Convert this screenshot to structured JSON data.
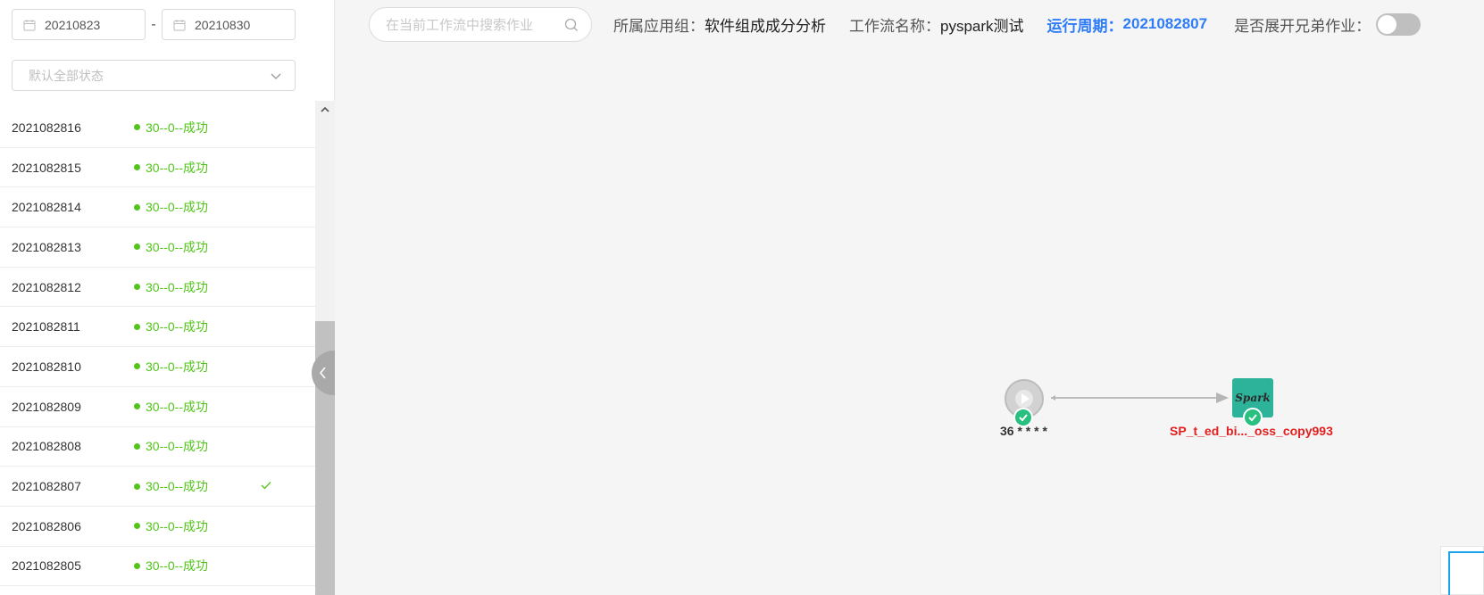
{
  "filter": {
    "start_date": "20210823",
    "separator": "-",
    "end_date": "20210830",
    "status_placeholder": "默认全部状态"
  },
  "runs": [
    {
      "period": "2021082816",
      "status": "30--0--成功",
      "selected": false
    },
    {
      "period": "2021082815",
      "status": "30--0--成功",
      "selected": false
    },
    {
      "period": "2021082814",
      "status": "30--0--成功",
      "selected": false
    },
    {
      "period": "2021082813",
      "status": "30--0--成功",
      "selected": false
    },
    {
      "period": "2021082812",
      "status": "30--0--成功",
      "selected": false
    },
    {
      "period": "2021082811",
      "status": "30--0--成功",
      "selected": false
    },
    {
      "period": "2021082810",
      "status": "30--0--成功",
      "selected": false
    },
    {
      "period": "2021082809",
      "status": "30--0--成功",
      "selected": false
    },
    {
      "period": "2021082808",
      "status": "30--0--成功",
      "selected": false
    },
    {
      "period": "2021082807",
      "status": "30--0--成功",
      "selected": true
    },
    {
      "period": "2021082806",
      "status": "30--0--成功",
      "selected": false
    },
    {
      "period": "2021082805",
      "status": "30--0--成功",
      "selected": false
    }
  ],
  "header": {
    "search_placeholder": "在当前工作流中搜索作业",
    "app_group_label": "所属应用组：",
    "app_group_value": "软件组成成分分析",
    "workflow_label": "工作流名称：",
    "workflow_value": "pyspark测试",
    "period_label": "运行周期：",
    "period_value": "2021082807",
    "expand_label": "是否展开兄弟作业：",
    "expand_enabled": false
  },
  "graph": {
    "start_node_label": "36 * * * *",
    "spark_node_label": "SP_t_ed_bi..._oss_copy993",
    "spark_icon_text": "Spark",
    "start_status": "success",
    "spark_status": "success"
  },
  "colors": {
    "success": "#52c41a",
    "accent": "#2f7df6",
    "node_label_error": "#e02020",
    "badge": "#27c07f"
  }
}
